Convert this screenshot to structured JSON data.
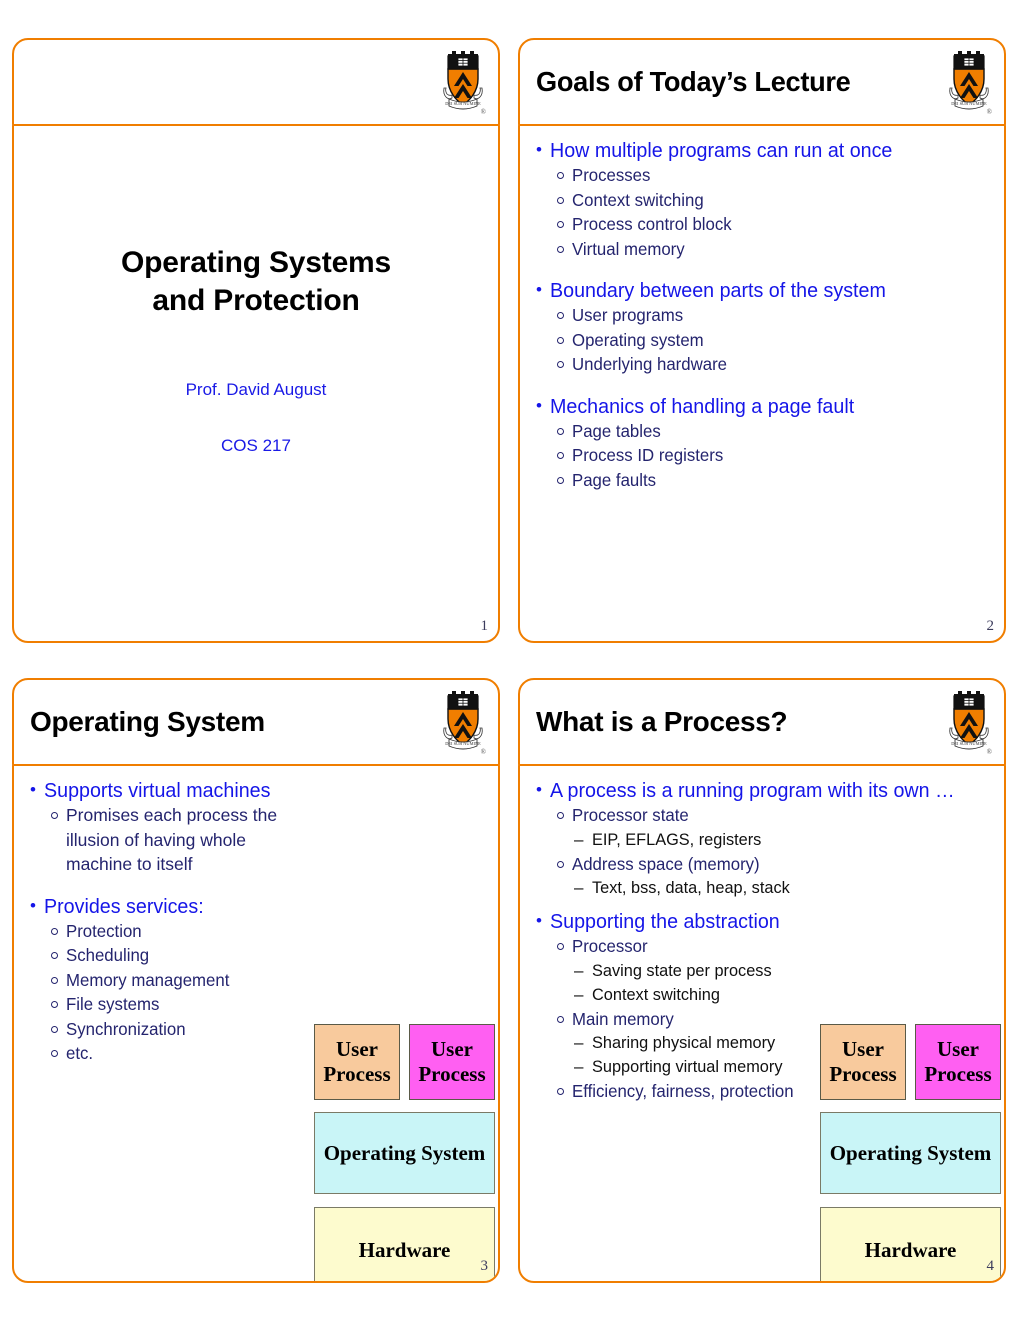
{
  "accent_color": "#F07E00",
  "bullet_color": "#1515E8",
  "subbullet_color": "#24246E",
  "logo": {
    "name": "princeton-shield",
    "caption": "®"
  },
  "slides": [
    {
      "number": "1",
      "title": "",
      "title_block": {
        "line1": "Operating Systems",
        "line2": "and Protection",
        "presenter": "Prof. David August",
        "course": "COS 217"
      }
    },
    {
      "number": "2",
      "title": "Goals of Today’s Lecture",
      "groups": [
        {
          "bullet": "How multiple programs can run at once",
          "items": [
            "Processes",
            "Context switching",
            "Process control block",
            "Virtual memory"
          ]
        },
        {
          "bullet": "Boundary between parts of the system",
          "items": [
            "User programs",
            "Operating system",
            "Underlying hardware"
          ]
        },
        {
          "bullet": "Mechanics of handling a page fault",
          "items": [
            "Page tables",
            "Process ID registers",
            "Page faults"
          ]
        }
      ]
    },
    {
      "number": "3",
      "title": "Operating System",
      "groups": [
        {
          "bullet": "Supports virtual machines",
          "items": [
            "Promises each process the illusion of having whole machine to itself"
          ]
        },
        {
          "bullet": "Provides services:",
          "items": [
            "Protection",
            "Scheduling",
            "Memory management",
            "File systems",
            "Synchronization",
            "etc."
          ]
        }
      ],
      "diagram": {
        "user_process_left": "User Process",
        "user_process_right": "User Process",
        "operating_system": "Operating System",
        "hardware": "Hardware",
        "colors": {
          "user_process_left": "#F8CA9D",
          "user_process_right": "#FF5FF2",
          "operating_system": "#C9F5F7",
          "hardware": "#FDFBCE"
        }
      }
    },
    {
      "number": "4",
      "title": "What is a Process?",
      "groups": [
        {
          "bullet": "A process is a running program with its own …",
          "items": [
            {
              "text": "Processor state",
              "sub": [
                "EIP, EFLAGS, registers"
              ]
            },
            {
              "text": "Address space (memory)",
              "sub": [
                "Text, bss, data, heap, stack"
              ]
            }
          ]
        },
        {
          "bullet": "Supporting the abstraction",
          "items": [
            {
              "text": "Processor",
              "sub": [
                "Saving state per process",
                "Context switching"
              ]
            },
            {
              "text": "Main memory",
              "sub": [
                "Sharing physical memory",
                "Supporting virtual memory"
              ]
            },
            {
              "text": "Efficiency, fairness, protection",
              "sub": []
            }
          ]
        }
      ],
      "diagram": {
        "user_process_left": "User Process",
        "user_process_right": "User Process",
        "operating_system": "Operating System",
        "hardware": "Hardware",
        "colors": {
          "user_process_left": "#F8CA9D",
          "user_process_right": "#FF5FF2",
          "operating_system": "#C9F5F7",
          "hardware": "#FDFBCE"
        }
      }
    }
  ]
}
